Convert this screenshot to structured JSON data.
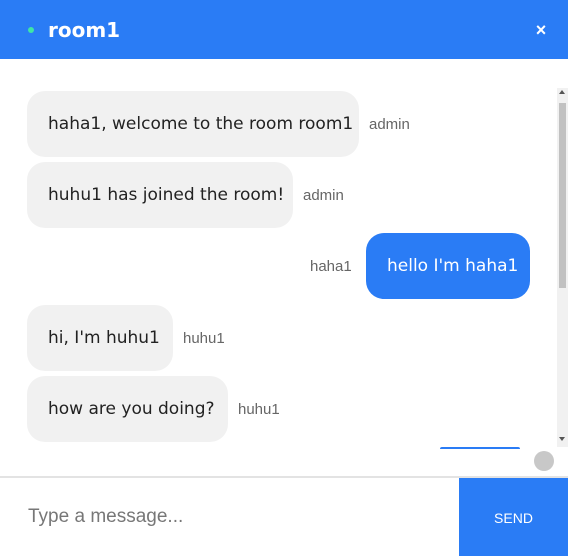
{
  "header": {
    "title": "room1",
    "close_icon": "×",
    "status": "online",
    "accent": "#2a7cf5",
    "status_color": "#3ee6a6"
  },
  "messages": [
    {
      "text": "haha1, welcome to the room room1",
      "sender": "admin",
      "direction": "incoming"
    },
    {
      "text": "huhu1 has joined the room!",
      "sender": "admin",
      "direction": "incoming"
    },
    {
      "text": "hello I'm haha1",
      "sender": "haha1",
      "direction": "outgoing"
    },
    {
      "text": "hi, I'm huhu1",
      "sender": "huhu1",
      "direction": "incoming"
    },
    {
      "text": "how are you doing?",
      "sender": "huhu1",
      "direction": "incoming"
    }
  ],
  "composer": {
    "placeholder": "Type a message...",
    "value": "",
    "send_label": "SEND"
  }
}
